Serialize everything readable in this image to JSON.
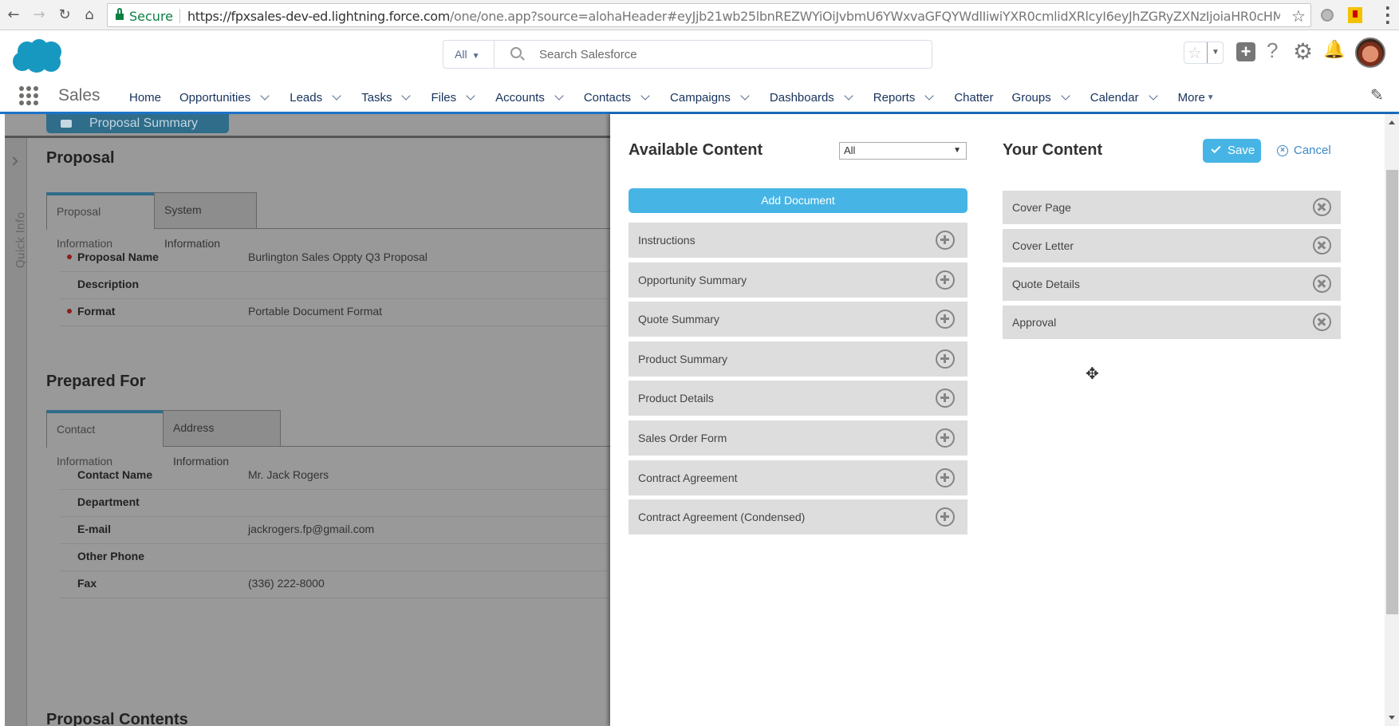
{
  "browser": {
    "back_icon": "arrow-left-icon",
    "forward_icon": "arrow-right-icon",
    "reload_icon": "reload-icon",
    "home_icon": "home-icon",
    "secure_label": "Secure",
    "url_host": "https://fpxsales-dev-ed.lightning.force.com",
    "url_rest": "/one/one.app?source=alohaHeader#eyJjb21wb25lbnREZWYiOiJvbmU6YWxvaGFQYWdlIiwiYXR0cmlidXRlcyI6eyJhZGRyZXNzIjoiaHR0cHM6Ly9mcHhzY..."
  },
  "header": {
    "search_scope": "All",
    "search_placeholder": "Search Salesforce",
    "app_name": "Sales",
    "add_icon": "+",
    "help_icon": "?",
    "gear_icon": "⚙",
    "bell_icon": "🔔",
    "edit_icon": "✎"
  },
  "nav": {
    "items": [
      {
        "label": "Home",
        "dropdown": false
      },
      {
        "label": "Opportunities",
        "dropdown": true
      },
      {
        "label": "Leads",
        "dropdown": true
      },
      {
        "label": "Tasks",
        "dropdown": true
      },
      {
        "label": "Files",
        "dropdown": true
      },
      {
        "label": "Accounts",
        "dropdown": true
      },
      {
        "label": "Contacts",
        "dropdown": true
      },
      {
        "label": "Campaigns",
        "dropdown": true
      },
      {
        "label": "Dashboards",
        "dropdown": true
      },
      {
        "label": "Reports",
        "dropdown": true
      },
      {
        "label": "Chatter",
        "dropdown": false
      },
      {
        "label": "Groups",
        "dropdown": true
      },
      {
        "label": "Calendar",
        "dropdown": true
      },
      {
        "label": "More",
        "dropdown": "triangle"
      }
    ]
  },
  "page": {
    "top_tab": "Proposal Summary",
    "quick_info": "Quick Info",
    "proposal": {
      "title": "Proposal",
      "tabs": [
        "Proposal Information",
        "System Information"
      ],
      "fields": [
        {
          "label": "Proposal Name",
          "value": "Burlington Sales Oppty Q3 Proposal",
          "required": true
        },
        {
          "label": "Description",
          "value": "",
          "required": false
        },
        {
          "label": "Format",
          "value": "Portable Document Format",
          "required": true
        }
      ]
    },
    "prepared_for": {
      "title": "Prepared For",
      "tabs": [
        "Contact Information",
        "Address Information"
      ],
      "fields": [
        {
          "label": "Contact Name",
          "value": "Mr. Jack Rogers"
        },
        {
          "label": "Department",
          "value": ""
        },
        {
          "label": "E-mail",
          "value": "jackrogers.fp@gmail.com"
        },
        {
          "label": "Other Phone",
          "value": ""
        },
        {
          "label": "Fax",
          "value": "(336) 222-8000"
        }
      ]
    },
    "contents_title": "Proposal Contents"
  },
  "panel": {
    "available": {
      "title": "Available Content",
      "filter_value": "All",
      "add_document_label": "Add Document",
      "items": [
        "Instructions",
        "Opportunity Summary",
        "Quote Summary",
        "Product Summary",
        "Product Details",
        "Sales Order Form",
        "Contract Agreement",
        "Contract Agreement (Condensed)"
      ]
    },
    "yours": {
      "title": "Your Content",
      "save_label": "Save",
      "cancel_label": "Cancel",
      "items": [
        "Cover Page",
        "Cover Letter",
        "Quote Details",
        "Approval"
      ]
    }
  }
}
